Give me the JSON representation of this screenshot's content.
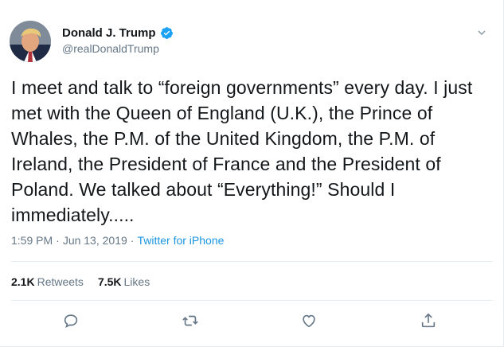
{
  "user": {
    "display_name": "Donald J. Trump",
    "handle": "@realDonaldTrump",
    "verified": true
  },
  "tweet": {
    "text": "I meet and talk to “foreign governments” every day. I just\nmet with the Queen of England (U.K.), the Prince of\nWhales, the P.M. of the United Kingdom, the P.M. of\nIreland, the President of France and the President of\nPoland. We talked about “Everything!” Should I\nimmediately....."
  },
  "meta": {
    "time": "1:59 PM",
    "separator1": "·",
    "date": "Jun 13, 2019",
    "separator2": "·",
    "source": "Twitter for iPhone"
  },
  "stats": {
    "retweets_count": "2.1K",
    "retweets_label": "Retweets",
    "likes_count": "7.5K",
    "likes_label": "Likes"
  },
  "icons": {
    "reply": "reply-icon",
    "retweet": "retweet-icon",
    "like": "like-icon",
    "share": "share-icon",
    "caret": "chevron-down-icon"
  },
  "colors": {
    "text": "#14171a",
    "secondary": "#657786",
    "accent": "#1b95e0",
    "verified": "#1da1f2"
  }
}
